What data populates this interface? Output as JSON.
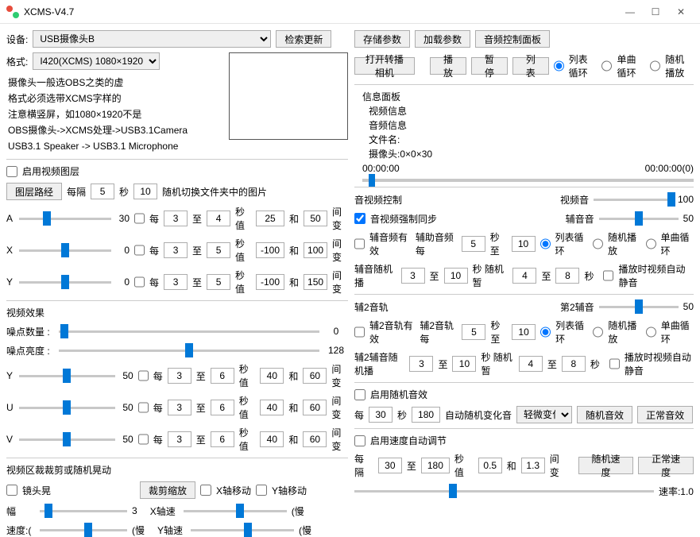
{
  "title": "XCMS-V4.7",
  "device_label": "设备:",
  "device": "USB摄像头B",
  "btn_search": "检索更新",
  "btn_save": "存储参数",
  "btn_load": "加载参数",
  "btn_audio_panel": "音频控制面板",
  "format_label": "格式:",
  "format": "I420(XCMS) 1080×1920",
  "btn_open_cam": "打开转播相机",
  "btn_play": "播放",
  "btn_pause": "暂停",
  "btn_list": "列表",
  "loop_opts": {
    "a": "列表循环",
    "b": "单曲循环",
    "c": "随机播放"
  },
  "hints": [
    "摄像头一般选OBS之类的虚",
    "格式必须选带XCMS字样的",
    "注意横竖屏，如1080×1920不是",
    "OBS摄像头->XCMS处理->USB3.1Camera",
    "USB3.1 Speaker -> USB3.1 Microphone"
  ],
  "info": {
    "title": "信息面板",
    "lines": [
      "视频信息",
      "音频信息",
      "文件名:",
      "摄像头:0×0×30"
    ],
    "t1": "00:00:00",
    "t2": "00:00:00(0)"
  },
  "layer": {
    "enable": "启用视频图层",
    "btn": "图层路经",
    "t1": "每隔",
    "v1": "5",
    "t2": "秒",
    "v2": "10",
    "t3": "随机切换文件夹中的图片"
  },
  "axis": {
    "A": {
      "val": "30",
      "s1": "3",
      "s2": "4",
      "v1": "25",
      "v2": "50"
    },
    "X": {
      "val": "0",
      "s1": "3",
      "s2": "5",
      "v1": "-100",
      "v2": "100"
    },
    "Y": {
      "val": "0",
      "s1": "3",
      "s2": "5",
      "v1": "-100",
      "v2": "150"
    }
  },
  "ax_lbl": {
    "mei": "每",
    "zhi": "至",
    "miao": "秒值",
    "he": "和",
    "jian": "间变",
    "l": "(慢"
  },
  "fx": {
    "title": "视频效果",
    "noise_cnt": "噪点数量 :",
    "noise_cnt_v": "0",
    "noise_b": "噪点亮度 :",
    "noise_b_v": "128",
    "Y": {
      "val": "50",
      "s1": "3",
      "s2": "6",
      "v1": "40",
      "v2": "60"
    },
    "U": {
      "val": "50",
      "s1": "3",
      "s2": "6",
      "v1": "40",
      "v2": "60"
    },
    "V": {
      "val": "50",
      "s1": "3",
      "s2": "6",
      "v1": "40",
      "v2": "60"
    }
  },
  "crop": {
    "title": "视频区裁裁剪或随机晃动",
    "lens": "镜头晃",
    "btn": "裁剪缩放",
    "xm": "X轴移动",
    "ym": "Y轴移动",
    "fu": "幅",
    "xs": "X轴速",
    "ys": "Y轴速",
    "fu_v": "3",
    "speed": "速度:("
  },
  "avc": {
    "title": "音视频控制",
    "video_vol": "视频音",
    "v_vol": "100",
    "sync": "音视频强制同步",
    "aux": "辅音音",
    "aux_v": "50",
    "aux_en": "辅音频有效",
    "aux_each": "辅助音频每",
    "s1": "5",
    "t1": "秒至",
    "s2": "10",
    "r1": "列表循环",
    "r2": "随机播放",
    "r3": "单曲循环",
    "aux_rand": "辅音随机播",
    "rs1": "3",
    "rs2": "10",
    "rt": "秒 随机暂",
    "rp1": "4",
    "rp2": "8",
    "rs": "秒",
    "auto_mute": "播放时视频自动静音"
  },
  "t2": {
    "title": "辅2音轨",
    "vol": "第2辅音",
    "vol_v": "50",
    "en": "辅2音轨有效",
    "each": "辅2音轨每",
    "s1": "5",
    "s2": "10",
    "rand": "辅2辅音随机播",
    "rs1": "3",
    "rs2": "10",
    "rp1": "4",
    "rp2": "8"
  },
  "rfx": {
    "title": "启用随机音效",
    "mei": "每",
    "v1": "30",
    "miao": "秒",
    "v2": "180",
    "auto": "自动随机变化音",
    "sel": "轻微变化",
    "b1": "随机音效",
    "b2": "正常音效"
  },
  "spd": {
    "title": "启用速度自动调节",
    "mei": "每隔",
    "v1": "30",
    "zhi": "至",
    "v2": "180",
    "miao": "秒值",
    "v3": "0.5",
    "he": "和",
    "v4": "1.3",
    "jian": "间变",
    "b1": "随机速度",
    "b2": "正常速度",
    "rate": "速率:1.0"
  }
}
